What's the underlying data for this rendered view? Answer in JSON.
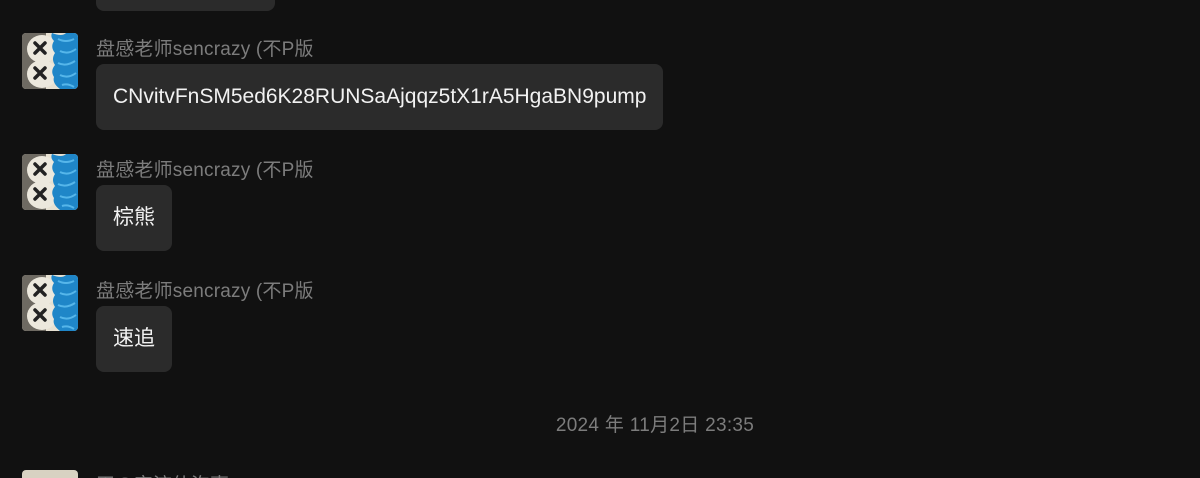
{
  "colors": {
    "background": "#111111",
    "bubble": "#2b2b2b",
    "bubble_text": "#f2f2f2",
    "meta_text": "#7c7c7c",
    "avatar_blue": "#1f86c8",
    "avatar_cream": "#e7e1d2"
  },
  "messages": [
    {
      "sender": "盘感老师sencrazy (不P版",
      "text": "CNvitvFnSM5ed6K28RUNSaAjqqz5tX1rA5HgaBN9pump",
      "avatar_icon": "kaws-avatar-icon"
    },
    {
      "sender": "盘感老师sencrazy (不P版",
      "text": "棕熊",
      "avatar_icon": "kaws-avatar-icon"
    },
    {
      "sender": "盘感老师sencrazy (不P版",
      "text": "速追",
      "avatar_icon": "kaws-avatar-icon"
    }
  ],
  "timestamp": "2024 年 11月2日 23:35",
  "next_message": {
    "sender_partial": "王の宫流仙泡事"
  }
}
